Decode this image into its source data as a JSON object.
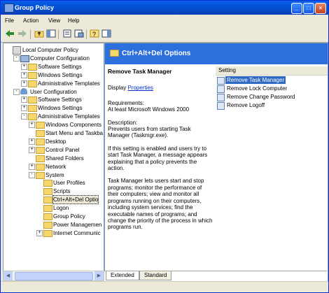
{
  "window": {
    "title": "Group Policy"
  },
  "menu": [
    "File",
    "Action",
    "View",
    "Help"
  ],
  "toolbar_icons": [
    "back-icon",
    "forward-icon",
    "up-folder-icon",
    "show-tree-icon",
    "properties-icon",
    "export-list-icon",
    "help-icon",
    "show-hide-icon"
  ],
  "tree": [
    {
      "label": "Local Computer Policy",
      "icon": "policy",
      "level": 0,
      "exp": ""
    },
    {
      "label": "Computer Configuration",
      "icon": "comp",
      "level": 1,
      "exp": "-"
    },
    {
      "label": "Software Settings",
      "icon": "folder",
      "level": 2,
      "exp": "+"
    },
    {
      "label": "Windows Settings",
      "icon": "folder",
      "level": 2,
      "exp": "+"
    },
    {
      "label": "Administrative Templates",
      "icon": "folder",
      "level": 2,
      "exp": "+"
    },
    {
      "label": "User Configuration",
      "icon": "user",
      "level": 1,
      "exp": "-"
    },
    {
      "label": "Software Settings",
      "icon": "folder",
      "level": 2,
      "exp": "+"
    },
    {
      "label": "Windows Settings",
      "icon": "folder",
      "level": 2,
      "exp": "+"
    },
    {
      "label": "Administrative Templates",
      "icon": "folder",
      "level": 2,
      "exp": "-"
    },
    {
      "label": "Windows Components",
      "icon": "folder",
      "level": 3,
      "exp": "+"
    },
    {
      "label": "Start Menu and Taskba",
      "icon": "folder",
      "level": 3,
      "exp": ""
    },
    {
      "label": "Desktop",
      "icon": "folder",
      "level": 3,
      "exp": "+"
    },
    {
      "label": "Control Panel",
      "icon": "folder",
      "level": 3,
      "exp": "+"
    },
    {
      "label": "Shared Folders",
      "icon": "folder",
      "level": 3,
      "exp": ""
    },
    {
      "label": "Network",
      "icon": "folder",
      "level": 3,
      "exp": "+"
    },
    {
      "label": "System",
      "icon": "folder",
      "level": 3,
      "exp": "-"
    },
    {
      "label": "User Profiles",
      "icon": "folder",
      "level": 4,
      "exp": ""
    },
    {
      "label": "Scripts",
      "icon": "folder",
      "level": 4,
      "exp": ""
    },
    {
      "label": "Ctrl+Alt+Del Optio",
      "icon": "folder",
      "level": 4,
      "exp": "",
      "selected": true
    },
    {
      "label": "Logon",
      "icon": "folder",
      "level": 4,
      "exp": ""
    },
    {
      "label": "Group Policy",
      "icon": "folder",
      "level": 4,
      "exp": ""
    },
    {
      "label": "Power Managemen",
      "icon": "folder",
      "level": 4,
      "exp": ""
    },
    {
      "label": "Internet Communic",
      "icon": "folder",
      "level": 4,
      "exp": "+"
    }
  ],
  "header": {
    "title": "Ctrl+Alt+Del Options"
  },
  "description": {
    "title": "Remove Task Manager",
    "display_prefix": "Display ",
    "display_link": "Properties",
    "requirements_label": "Requirements:",
    "requirements": "At least Microsoft Windows 2000",
    "description_label": "Description:",
    "description": "Prevents users from starting Task Manager (Taskmgr.exe).",
    "para2": "If this setting is enabled and users try to start Task Manager, a message appears explaining that a policy prevents the action.",
    "para3": "Task Manager lets users start and stop programs; monitor the performance of their computers; view and monitor all programs running on their computers, including system services; find the executable names of programs; and change the priority of the process in which programs run."
  },
  "list": {
    "column": "Setting",
    "items": [
      {
        "label": "Remove Task Manager",
        "selected": true
      },
      {
        "label": "Remove Lock Computer"
      },
      {
        "label": "Remove Change Password"
      },
      {
        "label": "Remove Logoff"
      }
    ]
  },
  "tabs": [
    "Extended",
    "Standard"
  ]
}
